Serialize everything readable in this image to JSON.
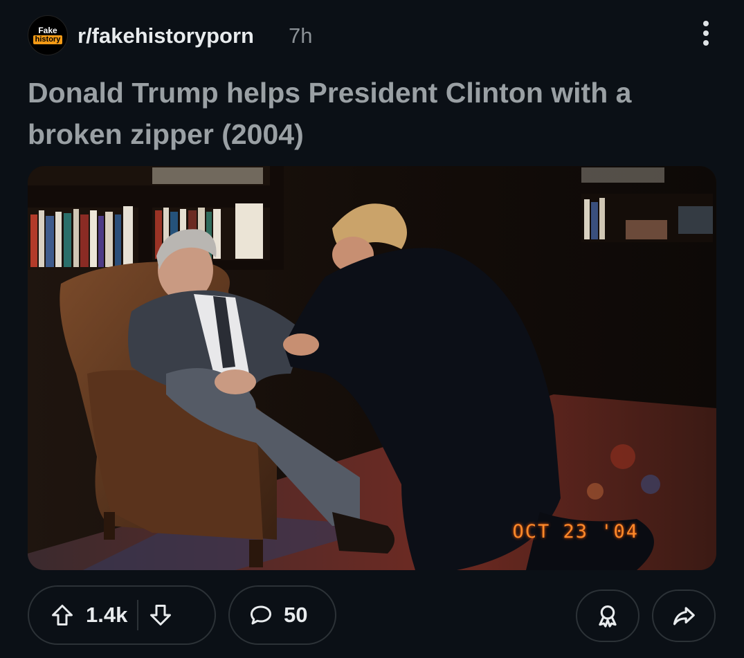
{
  "post": {
    "subreddit_avatar": {
      "line1": "Fake",
      "line2": "history"
    },
    "subreddit": "r/fakehistoryporn",
    "age": "7h",
    "title": "Donald Trump helps President Clinton with a broken zipper (2004)",
    "image_datestamp": "OCT 23 '04"
  },
  "actions": {
    "upvote_icon": "arrow-up-outline-icon",
    "score": "1.4k",
    "downvote_icon": "arrow-down-outline-icon",
    "comment_icon": "speech-bubble-icon",
    "comment_count": "50",
    "award_icon": "award-ribbon-icon",
    "share_icon": "share-arrow-icon"
  },
  "colors": {
    "background": "#0b1016",
    "subreddit_badge_orange": "#f39a16",
    "title_text": "#9aa0a4",
    "datestamp": "#ff8a2a",
    "pill_border": "#2c3237"
  }
}
